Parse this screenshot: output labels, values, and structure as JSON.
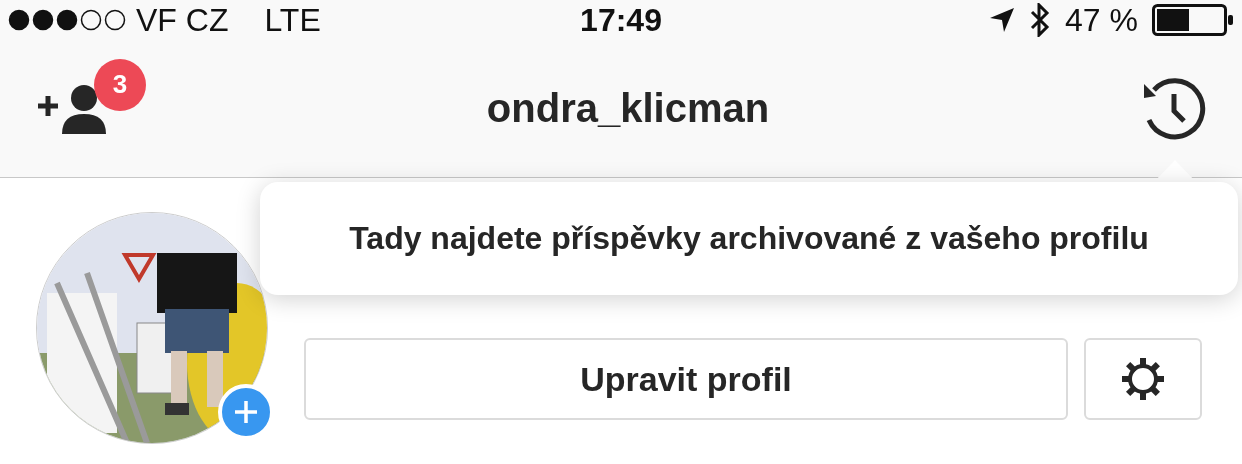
{
  "status_bar": {
    "carrier": "VF CZ",
    "network": "LTE",
    "time": "17:49",
    "battery": "47 %"
  },
  "nav_bar": {
    "title": "ondra_klicman",
    "badge": "3"
  },
  "profile": {
    "edit_button": "Upravit profil"
  },
  "tooltip": {
    "text": "Tady najdete příspěvky archivované z vašeho profilu"
  }
}
